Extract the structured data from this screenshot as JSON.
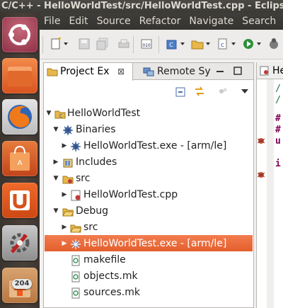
{
  "window": {
    "title": "C/C++ - HelloWorldTest/src/HelloWorldTest.cpp - Eclipse"
  },
  "launcher": {
    "items": [
      {
        "name": "ubuntu-icon"
      },
      {
        "name": "files-icon"
      },
      {
        "name": "firefox-icon"
      },
      {
        "name": "software-center-icon"
      },
      {
        "name": "ubuntu-one-icon"
      },
      {
        "name": "system-settings-icon"
      },
      {
        "name": "update-manager-icon"
      }
    ],
    "update_badge": "204"
  },
  "menu": {
    "items": [
      "File",
      "Edit",
      "Source",
      "Refactor",
      "Navigate",
      "Search"
    ]
  },
  "panel": {
    "tabs": [
      {
        "label": "Project Ex",
        "active": true
      },
      {
        "label": "Remote Sy",
        "active": false
      }
    ],
    "close_glyph": "⊠"
  },
  "tree": {
    "nodes": [
      {
        "label": "HelloWorldTest",
        "expanded": true
      },
      {
        "label": "Binaries",
        "expanded": true
      },
      {
        "label": "HelloWorldTest.exe - [arm/le]",
        "expanded": false
      },
      {
        "label": "Includes",
        "expanded": false
      },
      {
        "label": "src",
        "expanded": true
      },
      {
        "label": "HelloWorldTest.cpp",
        "expanded": false
      },
      {
        "label": "Debug",
        "expanded": true
      },
      {
        "label": "src",
        "expanded": false
      },
      {
        "label": "HelloWorldTest.exe - [arm/le]",
        "expanded": false,
        "selected": true
      },
      {
        "label": "makefile"
      },
      {
        "label": "objects.mk"
      },
      {
        "label": "sources.mk"
      }
    ]
  },
  "editor": {
    "tab_label": "He",
    "lines": [
      "/",
      "/",
      "#",
      "#",
      "u",
      "i"
    ]
  },
  "colors": {
    "selection": "#e45f2d",
    "titlebar": "#3b3a36",
    "menubar": "#353430"
  }
}
